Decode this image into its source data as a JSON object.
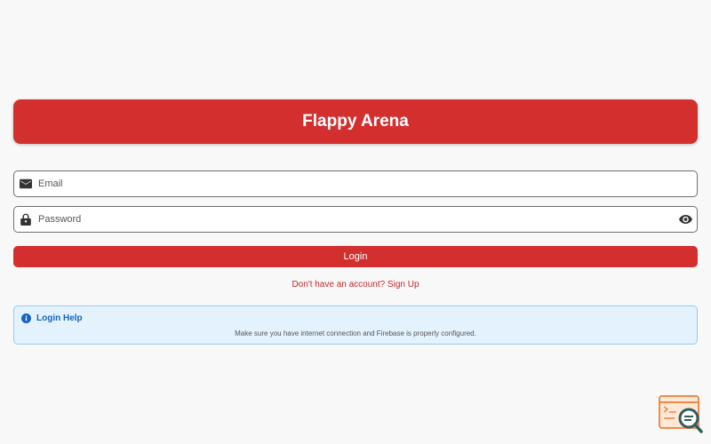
{
  "app": {
    "title": "Flappy Arena"
  },
  "form": {
    "email_placeholder": "Email",
    "email_value": "",
    "email_icon": "mail-icon",
    "password_placeholder": "Password",
    "password_value": "",
    "password_icon": "lock-icon",
    "visibility_icon": "eye-icon",
    "login_label": "Login",
    "signup_label": "Don't have an account? Sign Up"
  },
  "help": {
    "icon": "info-icon",
    "title": "Login Help",
    "text": "Make sure you have internet connection and Firebase is properly configured."
  },
  "colors": {
    "accent": "#d32f2f",
    "link": "#c62828",
    "info_bg": "#e3f2fd",
    "info_text": "#1565c0",
    "background": "#f8f8f8"
  }
}
